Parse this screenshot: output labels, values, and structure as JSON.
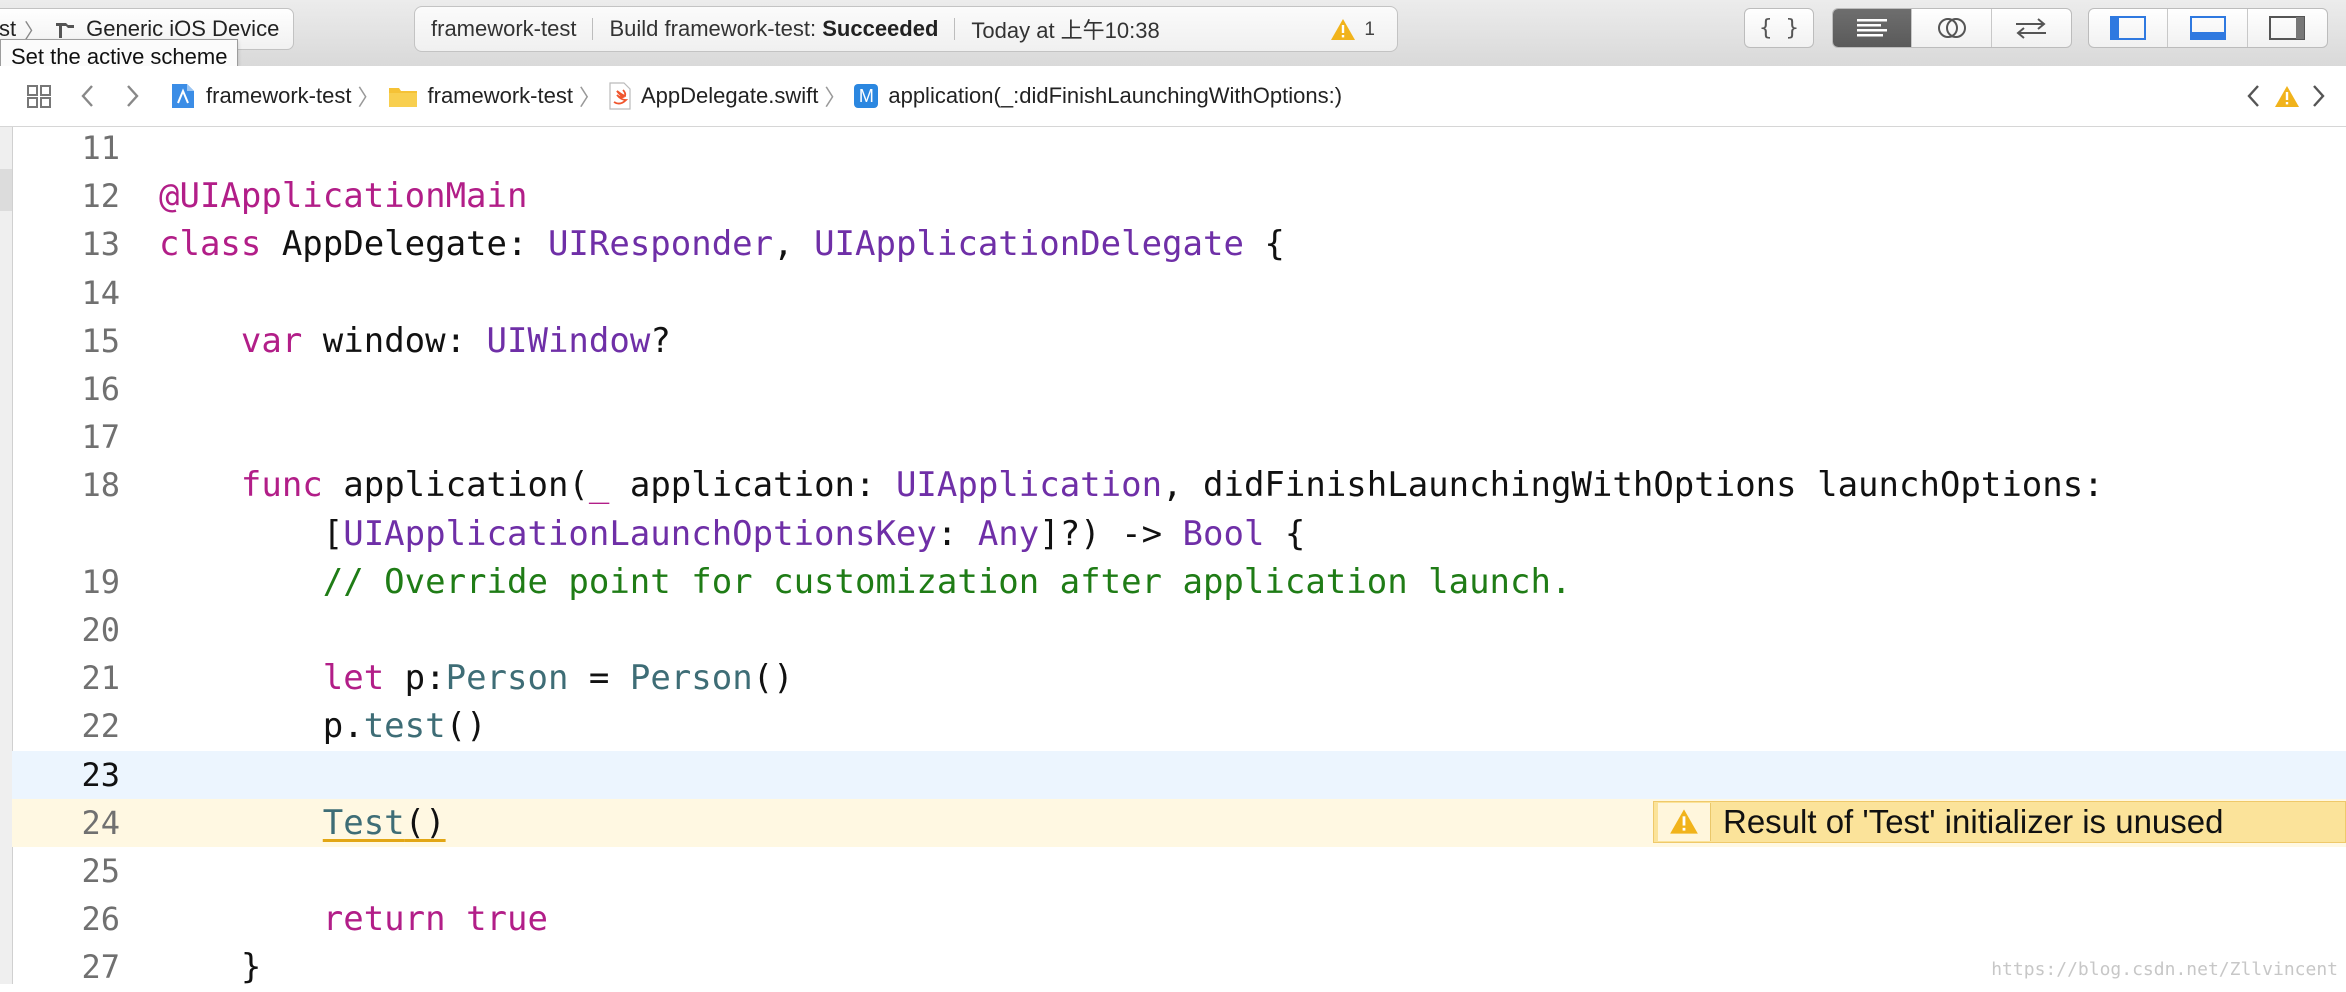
{
  "toolbar": {
    "scheme_project": "st",
    "scheme_device": "Generic iOS Device",
    "tooltip": "Set the active scheme",
    "activity": {
      "project": "framework-test",
      "build_prefix": "Build framework-test:",
      "build_status": "Succeeded",
      "time": "Today at 上午10:38",
      "warning_count": "1"
    },
    "editor_modes": {
      "standard_icon": "lines-icon",
      "assistant_icon": "rings-icon",
      "version_icon": "arrows-icon",
      "active": "standard"
    },
    "panels": {
      "navigator_icon": "left-panel-icon",
      "debug_icon": "bottom-panel-icon",
      "utilities_icon": "right-panel-icon"
    },
    "braces_label": "{ }"
  },
  "jumpbar": {
    "items": [
      "framework-test",
      "framework-test",
      "AppDelegate.swift",
      "application(_:didFinishLaunchingWithOptions:)"
    ],
    "method_badge": "M"
  },
  "editor": {
    "lines": [
      {
        "num": "11",
        "tokens": []
      },
      {
        "num": "12",
        "tokens": [
          {
            "t": "@UIApplicationMain",
            "c": "attr"
          }
        ]
      },
      {
        "num": "13",
        "tokens": [
          {
            "t": "class",
            "c": "kw"
          },
          {
            "t": " AppDelegate: ",
            "c": "plain"
          },
          {
            "t": "UIResponder",
            "c": "type"
          },
          {
            "t": ", ",
            "c": "plain"
          },
          {
            "t": "UIApplicationDelegate",
            "c": "type"
          },
          {
            "t": " {",
            "c": "plain"
          }
        ]
      },
      {
        "num": "14",
        "tokens": []
      },
      {
        "num": "15",
        "tokens": [
          {
            "t": "    ",
            "c": "plain"
          },
          {
            "t": "var",
            "c": "kw"
          },
          {
            "t": " window: ",
            "c": "plain"
          },
          {
            "t": "UIWindow",
            "c": "type"
          },
          {
            "t": "?",
            "c": "plain"
          }
        ]
      },
      {
        "num": "16",
        "tokens": []
      },
      {
        "num": "17",
        "tokens": []
      },
      {
        "num": "18",
        "tokens": [
          {
            "t": "    ",
            "c": "plain"
          },
          {
            "t": "func",
            "c": "kw"
          },
          {
            "t": " application(",
            "c": "plain"
          },
          {
            "t": "_",
            "c": "kw"
          },
          {
            "t": " application: ",
            "c": "plain"
          },
          {
            "t": "UIApplication",
            "c": "type"
          },
          {
            "t": ", didFinishLaunchingWithOptions launchOptions:",
            "c": "plain"
          }
        ]
      },
      {
        "num": "",
        "tokens": [
          {
            "t": "        [",
            "c": "plain"
          },
          {
            "t": "UIApplicationLaunchOptionsKey",
            "c": "type"
          },
          {
            "t": ": ",
            "c": "plain"
          },
          {
            "t": "Any",
            "c": "type"
          },
          {
            "t": "]?) -> ",
            "c": "plain"
          },
          {
            "t": "Bool",
            "c": "type"
          },
          {
            "t": " {",
            "c": "plain"
          }
        ]
      },
      {
        "num": "19",
        "tokens": [
          {
            "t": "        ",
            "c": "plain"
          },
          {
            "t": "// Override point for customization after application launch.",
            "c": "cmt"
          }
        ]
      },
      {
        "num": "20",
        "tokens": []
      },
      {
        "num": "21",
        "tokens": [
          {
            "t": "        ",
            "c": "plain"
          },
          {
            "t": "let",
            "c": "kw"
          },
          {
            "t": " p:",
            "c": "plain"
          },
          {
            "t": "Person",
            "c": "prj"
          },
          {
            "t": " = ",
            "c": "plain"
          },
          {
            "t": "Person",
            "c": "prj"
          },
          {
            "t": "()",
            "c": "plain"
          }
        ]
      },
      {
        "num": "22",
        "tokens": [
          {
            "t": "        p.",
            "c": "plain"
          },
          {
            "t": "test",
            "c": "prj"
          },
          {
            "t": "()",
            "c": "plain"
          }
        ]
      },
      {
        "num": "23",
        "tokens": [],
        "highlight": "current"
      },
      {
        "num": "24",
        "tokens": [
          {
            "t": "        ",
            "c": "plain"
          },
          {
            "t": "Test",
            "c": "prj uline"
          },
          {
            "t": "()",
            "c": "plain uline"
          }
        ],
        "highlight": "warning"
      },
      {
        "num": "25",
        "tokens": []
      },
      {
        "num": "26",
        "tokens": [
          {
            "t": "        ",
            "c": "plain"
          },
          {
            "t": "return",
            "c": "kw"
          },
          {
            "t": " ",
            "c": "plain"
          },
          {
            "t": "true",
            "c": "kw"
          }
        ]
      },
      {
        "num": "27",
        "tokens": [
          {
            "t": "    }",
            "c": "plain"
          }
        ]
      }
    ],
    "issue_message": "Result of 'Test' initializer is unused",
    "watermark": "https://blog.csdn.net/Zllvincent"
  }
}
